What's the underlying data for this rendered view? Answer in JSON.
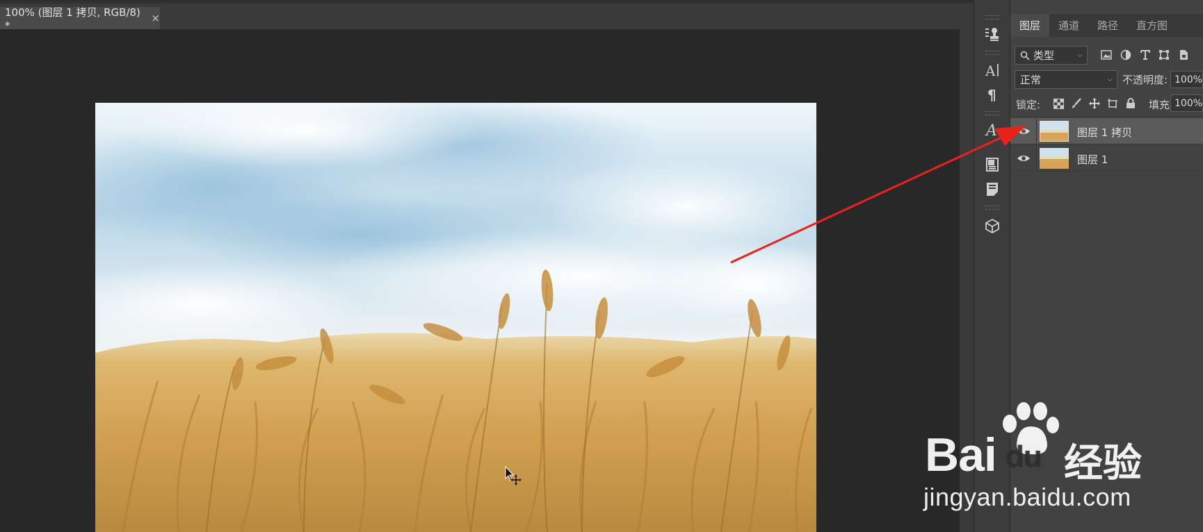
{
  "document": {
    "tab_title": "100% (图层 1 拷贝, RGB/8) *",
    "close_glyph": "×"
  },
  "panel": {
    "collapse_glyph": "◂◂",
    "tabs": [
      {
        "label": "图层",
        "active": true
      },
      {
        "label": "通道",
        "active": false
      },
      {
        "label": "路径",
        "active": false
      },
      {
        "label": "直方图",
        "active": false
      }
    ],
    "filter": {
      "value": "类型"
    },
    "blend_mode": {
      "value": "正常"
    },
    "opacity": {
      "label": "不透明度:",
      "value": "100%"
    },
    "lock": {
      "label": "锁定:"
    },
    "fill": {
      "label": "填充:",
      "value": "100%"
    },
    "layers": [
      {
        "name": "图层 1 拷贝",
        "selected": true,
        "visible": true
      },
      {
        "name": "图层 1",
        "selected": false,
        "visible": true
      }
    ]
  },
  "watermark": {
    "logo": "Bai du",
    "logo_part1": "Bai",
    "logo_part2": "du",
    "jingyan": "经验",
    "url": "jingyan.baidu.com"
  },
  "colors": {
    "annotation_arrow": "#e8231c",
    "sky": "#dfeef7",
    "wheat": "#d4a456"
  }
}
